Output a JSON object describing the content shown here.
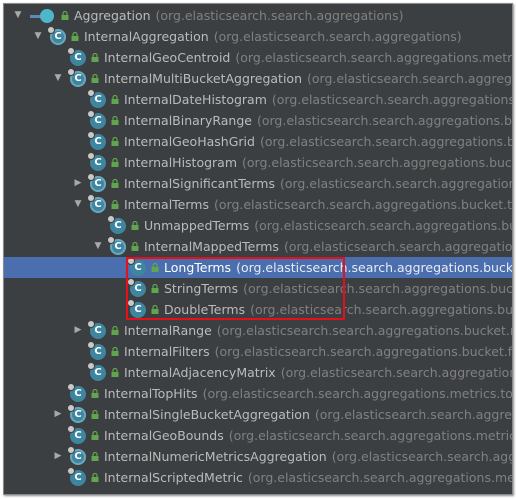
{
  "colors": {
    "background": "#3c3f41",
    "selection": "#4b6eaf",
    "class_icon": "#3e86a0",
    "name_text": "#bbbbbb",
    "package_text": "#808080",
    "highlight_box": "#e4101b"
  },
  "tree": {
    "rows": [
      {
        "name": "Aggregation",
        "package": "(org.elasticsearch.search.aggregations)",
        "depth": 0,
        "expander": "expanded",
        "icon": "interface-icon",
        "badge": "",
        "selected": false
      },
      {
        "name": "InternalAggregation",
        "package": "(org.elasticsearch.search.aggregations)",
        "depth": 1,
        "expander": "expanded",
        "icon": "abstract-class-icon",
        "badge": "C",
        "selected": false
      },
      {
        "name": "InternalGeoCentroid",
        "package": "(org.elasticsearch.search.aggregations.metrics.g",
        "depth": 2,
        "expander": "none",
        "icon": "class-icon",
        "badge": "C",
        "selected": false
      },
      {
        "name": "InternalMultiBucketAggregation",
        "package": "(org.elasticsearch.search.aggregatio",
        "depth": 2,
        "expander": "expanded",
        "icon": "abstract-class-icon",
        "badge": "C",
        "selected": false
      },
      {
        "name": "InternalDateHistogram",
        "package": "(org.elasticsearch.search.aggregations.bu",
        "depth": 3,
        "expander": "none",
        "icon": "class-icon",
        "badge": "C",
        "selected": false
      },
      {
        "name": "InternalBinaryRange",
        "package": "(org.elasticsearch.search.aggregations.bucket",
        "depth": 3,
        "expander": "none",
        "icon": "class-icon",
        "badge": "C",
        "selected": false
      },
      {
        "name": "InternalGeoHashGrid",
        "package": "(org.elasticsearch.search.aggregations.bucke",
        "depth": 3,
        "expander": "none",
        "icon": "class-icon",
        "badge": "C",
        "selected": false
      },
      {
        "name": "InternalHistogram",
        "package": "(org.elasticsearch.search.aggregations.bucket",
        "depth": 3,
        "expander": "none",
        "icon": "class-icon",
        "badge": "C",
        "selected": false
      },
      {
        "name": "InternalSignificantTerms",
        "package": "(org.elasticsearch.search.aggregations.b",
        "depth": 3,
        "expander": "collapsed",
        "icon": "abstract-class-icon",
        "badge": "C",
        "selected": false
      },
      {
        "name": "InternalTerms",
        "package": "(org.elasticsearch.search.aggregations.bucket.term",
        "depth": 3,
        "expander": "expanded",
        "icon": "abstract-class-icon",
        "badge": "C",
        "selected": false
      },
      {
        "name": "UnmappedTerms",
        "package": "(org.elasticsearch.search.aggregations.buck",
        "depth": 4,
        "expander": "none",
        "icon": "class-icon",
        "badge": "C",
        "selected": false
      },
      {
        "name": "InternalMappedTerms",
        "package": "(org.elasticsearch.search.aggregations.buck",
        "depth": 4,
        "expander": "expanded",
        "icon": "abstract-class-icon",
        "badge": "C",
        "selected": false
      },
      {
        "name": "LongTerms",
        "package": "(org.elasticsearch.search.aggregations.bucket",
        "depth": 5,
        "expander": "none",
        "icon": "class-icon",
        "badge": "C",
        "selected": true
      },
      {
        "name": "StringTerms",
        "package": "(org.elasticsearch.search.aggregations.bucke",
        "depth": 5,
        "expander": "none",
        "icon": "class-icon",
        "badge": "C",
        "selected": false
      },
      {
        "name": "DoubleTerms",
        "package": "(org.elasticsearch.search.aggregations.buck",
        "depth": 5,
        "expander": "none",
        "icon": "class-icon",
        "badge": "C",
        "selected": false
      },
      {
        "name": "InternalRange",
        "package": "(org.elasticsearch.search.aggregations.bucket.rang",
        "depth": 3,
        "expander": "collapsed",
        "icon": "class-icon",
        "badge": "C",
        "selected": false
      },
      {
        "name": "InternalFilters",
        "package": "(org.elasticsearch.search.aggregations.bucket.filter",
        "depth": 3,
        "expander": "none",
        "icon": "class-icon",
        "badge": "C",
        "selected": false
      },
      {
        "name": "InternalAdjacencyMatrix",
        "package": "(org.elasticsearch.search.aggregations.b",
        "depth": 3,
        "expander": "none",
        "icon": "class-icon",
        "badge": "C",
        "selected": false
      },
      {
        "name": "InternalTopHits",
        "package": "(org.elasticsearch.search.aggregations.metrics.tophi",
        "depth": 2,
        "expander": "none",
        "icon": "class-icon",
        "badge": "C",
        "selected": false
      },
      {
        "name": "InternalSingleBucketAggregation",
        "package": "(org.elasticsearch.search.aggregati",
        "depth": 2,
        "expander": "collapsed",
        "icon": "abstract-class-icon",
        "badge": "C",
        "selected": false
      },
      {
        "name": "InternalGeoBounds",
        "package": "(org.elasticsearch.search.aggregations.metrics.ge",
        "depth": 2,
        "expander": "none",
        "icon": "class-icon",
        "badge": "C",
        "selected": false
      },
      {
        "name": "InternalNumericMetricsAggregation",
        "package": "(org.elasticsearch.search.aggreg",
        "depth": 2,
        "expander": "collapsed",
        "icon": "abstract-class-icon",
        "badge": "C",
        "selected": false
      },
      {
        "name": "InternalScriptedMetric",
        "package": "(org.elasticsearch.search.aggregations.metr",
        "depth": 2,
        "expander": "none",
        "icon": "class-icon",
        "badge": "C",
        "selected": false
      }
    ]
  }
}
